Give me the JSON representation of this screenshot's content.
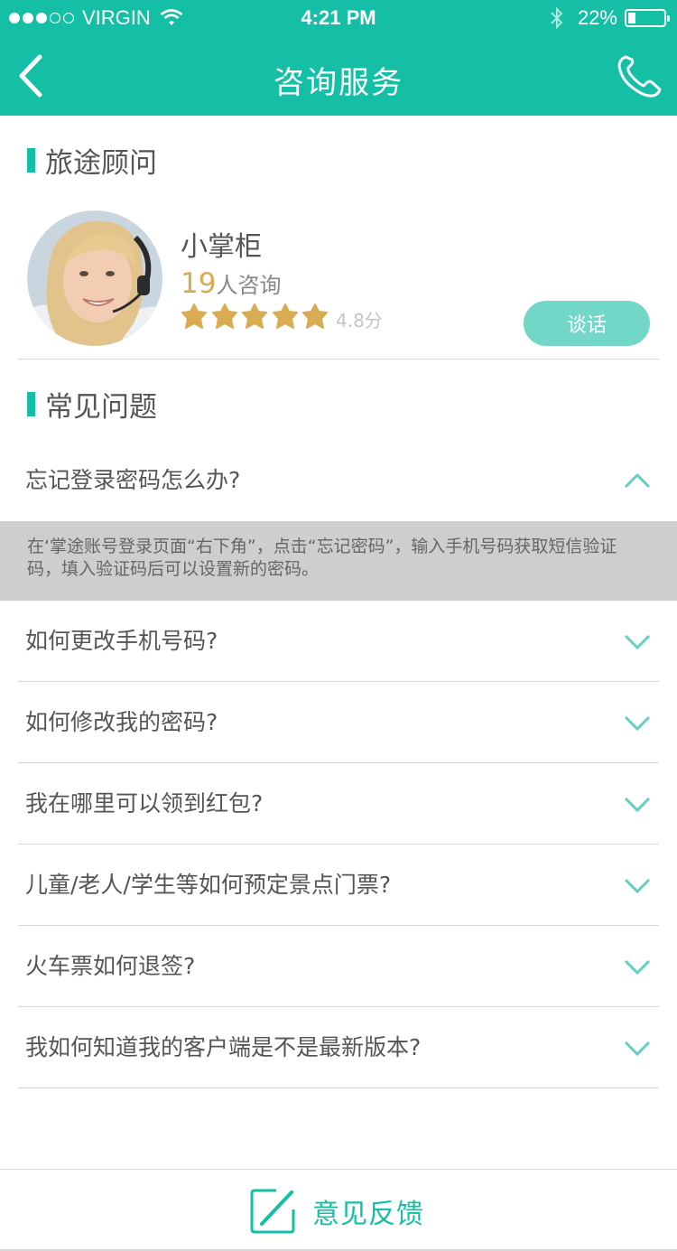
{
  "status_bar": {
    "carrier": "VIRGIN",
    "time": "4:21 PM",
    "battery": "22%",
    "battery_level": 0.22,
    "signal_bars_filled": 3,
    "signal_bars_total": 5
  },
  "header": {
    "title": "咨询服务"
  },
  "advisor_section": {
    "title": "旅途顾问",
    "name": "小掌柜",
    "count": "19",
    "count_suffix": "人咨询",
    "rating": "4.8分",
    "stars": 5,
    "talk_button": "谈话"
  },
  "faq_section": {
    "title": "常见问题",
    "items": [
      {
        "question": "忘记登录密码怎么办?",
        "expanded": true
      },
      {
        "question": "如何更改手机号码?",
        "expanded": false
      },
      {
        "question": "如何修改我的密码?",
        "expanded": false
      },
      {
        "question": "我在哪里可以领到红包?",
        "expanded": false
      },
      {
        "question": "儿童/老人/学生等如何预定景点门票?",
        "expanded": false
      },
      {
        "question": "火车票如何退签?",
        "expanded": false
      },
      {
        "question": "我如何知道我的客户端是不是最新版本?",
        "expanded": false
      }
    ],
    "answer": "在‘掌途账号登录页面“右下角”，点击“忘记密码”，输入手机号码获取短信验证码，填入验证码后可以设置新的密码。"
  },
  "footer": {
    "feedback_label": "意见反馈"
  },
  "colors": {
    "accent": "#14bfa6",
    "star": "#d9ac54",
    "talk_button": "#72d7c7",
    "answer_bg": "#cecece"
  }
}
